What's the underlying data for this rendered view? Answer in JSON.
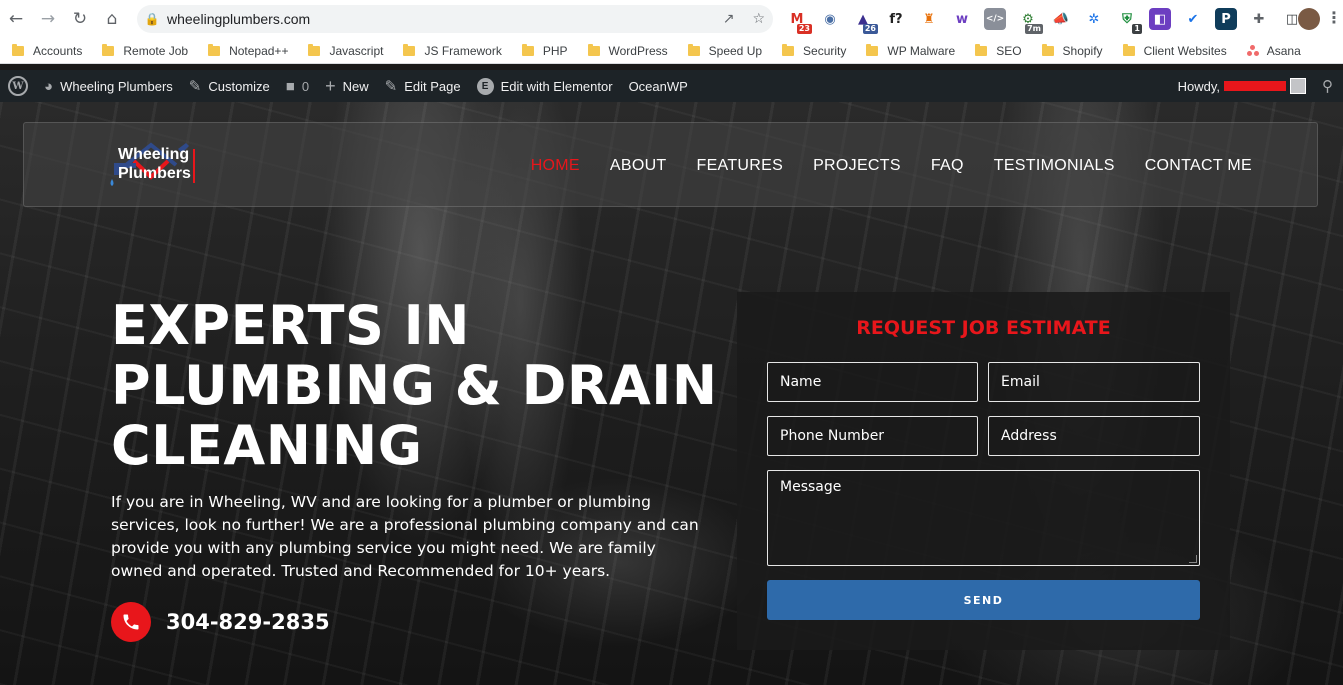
{
  "browser": {
    "url": "wheelingplumbers.com",
    "extensions": [
      {
        "name": "gmail-icon",
        "glyph": "M",
        "color": "#d93025",
        "bg": "#ffffff",
        "badge": "23",
        "badge_color": "#d93025"
      },
      {
        "name": "eye-icon",
        "glyph": "◉",
        "color": "#4a6fa5",
        "bg": "#ffffff",
        "badge": "",
        "badge_color": ""
      },
      {
        "name": "graduation-icon",
        "glyph": "▲",
        "color": "#3b2f8f",
        "bg": "#ffffff",
        "badge": "26",
        "badge_color": "#3b5998"
      },
      {
        "name": "font-question-icon",
        "glyph": "f?",
        "color": "#222222",
        "bg": "#ffffff",
        "badge": "",
        "badge_color": ""
      },
      {
        "name": "lighthouse-icon",
        "glyph": "♜",
        "color": "#e8710a",
        "bg": "#ffffff",
        "badge": "",
        "badge_color": ""
      },
      {
        "name": "wappalyzer-icon",
        "glyph": "w",
        "color": "#6c3ec1",
        "bg": "#ffffff",
        "badge": "",
        "badge_color": ""
      },
      {
        "name": "code-icon",
        "glyph": "</>",
        "color": "#ffffff",
        "bg": "#8a8f99",
        "badge": "",
        "badge_color": ""
      },
      {
        "name": "timer-icon",
        "glyph": "⚙",
        "color": "#2e7d32",
        "bg": "#ffffff",
        "badge": "7m",
        "badge_color": "#5f6368"
      },
      {
        "name": "megaphone-icon",
        "glyph": "📣",
        "color": "#e8710a",
        "bg": "#ffffff",
        "badge": "",
        "badge_color": ""
      },
      {
        "name": "snowflake-icon",
        "glyph": "✲",
        "color": "#1a73e8",
        "bg": "#ffffff",
        "badge": "",
        "badge_color": ""
      },
      {
        "name": "shield-icon",
        "glyph": "⛨",
        "color": "#1e8e3e",
        "bg": "#ffffff",
        "badge": "1",
        "badge_color": "#3c4043"
      },
      {
        "name": "reader-icon",
        "glyph": "◧",
        "color": "#ffffff",
        "bg": "#6c3ec1",
        "badge": "",
        "badge_color": ""
      },
      {
        "name": "check-icon",
        "glyph": "✔",
        "color": "#1a73e8",
        "bg": "#ffffff",
        "badge": "",
        "badge_color": ""
      },
      {
        "name": "pinterest-icon",
        "glyph": "P",
        "color": "#ffffff",
        "bg": "#0f3c5a",
        "badge": "",
        "badge_color": ""
      },
      {
        "name": "puzzle-icon",
        "glyph": "✚",
        "color": "#5f6368",
        "bg": "#ffffff",
        "badge": "",
        "badge_color": ""
      },
      {
        "name": "sidebar-icon",
        "glyph": "◫",
        "color": "#3c4043",
        "bg": "#ffffff",
        "badge": "",
        "badge_color": ""
      }
    ],
    "bookmarks": [
      "Accounts",
      "Remote Job",
      "Notepad++",
      "Javascript",
      "JS Framework",
      "PHP",
      "WordPress",
      "Speed Up",
      "Security",
      "WP Malware",
      "SEO",
      "Shopify",
      "Client Websites"
    ],
    "bookmark_asana": "Asana"
  },
  "admin_bar": {
    "site_name": "Wheeling Plumbers",
    "customize": "Customize",
    "comments_count": "0",
    "new": "New",
    "edit_page": "Edit Page",
    "elementor": "Edit with Elementor",
    "theme": "OceanWP",
    "howdy": "Howdy,"
  },
  "site": {
    "logo_line1": "Wheeling",
    "logo_line2": "Plumbers",
    "nav": [
      {
        "label": "HOME",
        "active": true
      },
      {
        "label": "ABOUT",
        "active": false
      },
      {
        "label": "FEATURES",
        "active": false
      },
      {
        "label": "PROJECTS",
        "active": false
      },
      {
        "label": "FAQ",
        "active": false
      },
      {
        "label": "TESTIMONIALS",
        "active": false
      },
      {
        "label": "CONTACT ME",
        "active": false
      }
    ],
    "accent_color": "#e8161b",
    "button_color": "#2e6aaa"
  },
  "hero": {
    "headline_line1": "EXPERTS IN",
    "headline_line2": "PLUMBING & DRAIN",
    "headline_line3": "CLEANING",
    "intro": "If you are in Wheeling, WV and are looking for a plumber or plumbing services, look no further! We are a professional plumbing company and can provide you with any plumbing service you might need. We are family owned and operated. Trusted and Recommended for 10+ years.",
    "phone": "304-829-2835"
  },
  "form": {
    "title": "REQUEST JOB ESTIMATE",
    "name_placeholder": "Name",
    "email_placeholder": "Email",
    "phone_placeholder": "Phone Number",
    "address_placeholder": "Address",
    "message_placeholder": "Message",
    "send_label": "SEND"
  }
}
